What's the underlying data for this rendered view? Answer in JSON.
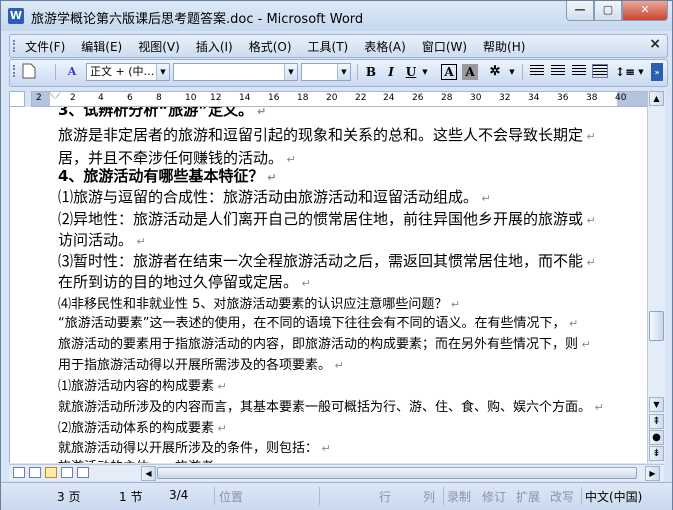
{
  "window": {
    "title": "旅游学概论第六版课后思考题答案.doc - Microsoft Word",
    "app_icon": "word-icon",
    "min_label": "—",
    "max_label": "▢",
    "close_label": "✕"
  },
  "menubar": {
    "items": [
      "文件(F)",
      "编辑(E)",
      "视图(V)",
      "插入(I)",
      "格式(O)",
      "工具(T)",
      "表格(A)",
      "窗口(W)",
      "帮助(H)"
    ],
    "close_label": "×"
  },
  "toolbar": {
    "style_value": "正文 + (中…",
    "font_value": "",
    "size_value": "",
    "bold": "B",
    "italic": "I",
    "underline": "U",
    "char_border": "A",
    "char_shading": "A"
  },
  "ruler": {
    "numbers": [
      "2",
      "2",
      "4",
      "6",
      "8",
      "10",
      "12",
      "14",
      "16",
      "18",
      "20",
      "22",
      "24",
      "26",
      "28",
      "30",
      "32",
      "34",
      "36",
      "38",
      "40"
    ]
  },
  "document": {
    "lines": [
      "3、试辨析分析“旅游”定义。",
      "旅游是非定居者的旅游和逗留引起的现象和关系的总和。这些人不会导致长期定",
      "居，并且不牵涉任何赚钱的活动。",
      "4、旅游活动有哪些基本特征？",
      "⑴旅游与逗留的合成性：旅游活动由旅游活动和逗留活动组成。",
      "⑵异地性：旅游活动是人们离开自己的惯常居住地，前往异国他乡开展的旅游或",
      "访问活动。",
      "⑶暂时性：旅游者在结束一次全程旅游活动之后，需返回其惯常居住地，而不能",
      "在所到访的目的地过久停留或定居。",
      "⑷非移民性和非就业性 5、对旅游活动要素的认识应注意哪些问题？",
      "“旅游活动要素”这一表述的使用，在不同的语境下往往会有不同的语义。在有些情况下，",
      "旅游活动的要素用于指旅游活动的内容，即旅游活动的构成要素；而在另外有些情况下，则",
      "用于指旅游活动得以开展所需涉及的各项要素。",
      "⑴旅游活动内容的构成要素",
      "就旅游活动所涉及的内容而言，其基本要素一般可概括为行、游、住、食、购、娱六个方面。",
      "⑵旅游活动体系的构成要素",
      "就旅游活动得以开展所涉及的条件，则包括：",
      "旅游活动的主体——旅游者"
    ]
  },
  "statusbar": {
    "page": "3 页",
    "section": "1 节",
    "pages": "3/4",
    "position": "位置",
    "line": "行",
    "column": "列",
    "rec": "录制",
    "trk": "修订",
    "ext": "扩展",
    "ovr": "改写",
    "language": "中文(中国)"
  },
  "colors": {
    "frame": "#d6e4f5",
    "accent": "#2b5fb3"
  }
}
